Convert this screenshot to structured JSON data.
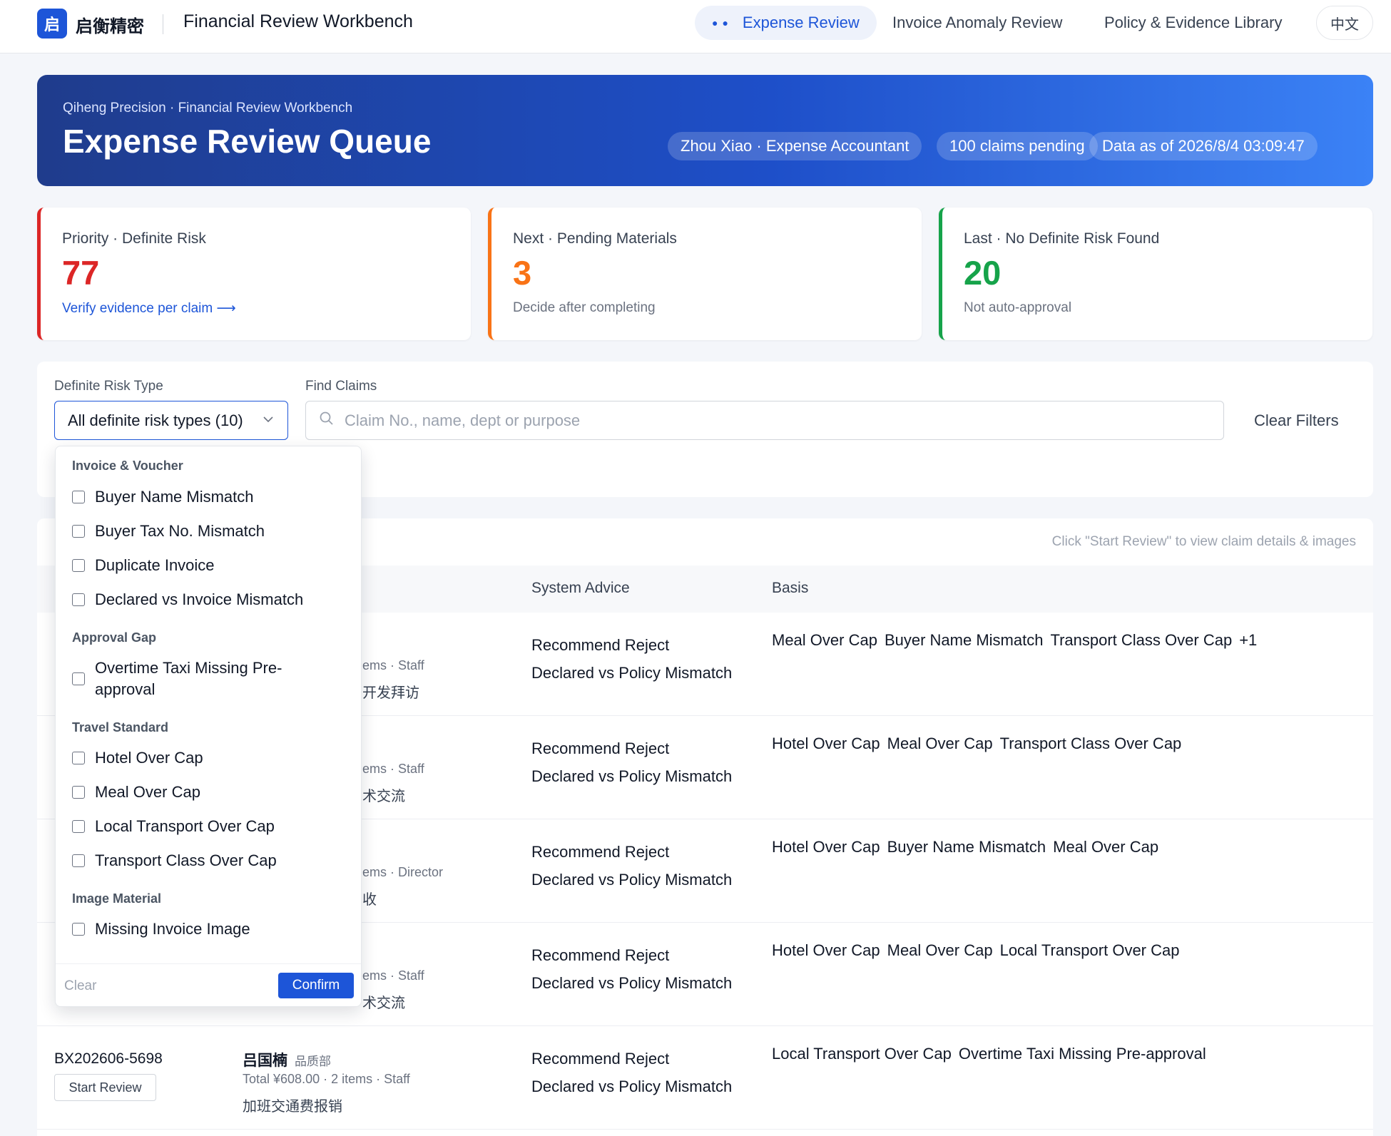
{
  "app": {
    "logo_char": "启",
    "brand": "启衡精密",
    "title": "Financial Review Workbench",
    "nav": [
      {
        "label": "Expense Review",
        "active": true
      },
      {
        "label": "Invoice Anomaly Review",
        "active": false
      },
      {
        "label": "Policy & Evidence Library",
        "active": false
      }
    ],
    "lang": "中文"
  },
  "hero": {
    "subtitle": "Qiheng Precision · Financial Review Workbench",
    "title": "Expense Review Queue",
    "user": "Zhou Xiao · Expense Accountant",
    "pending": "100 claims pending",
    "data_as_of": "Data as of 2026/8/4 03:09:47"
  },
  "stats": [
    {
      "label": "Priority · Definite Risk",
      "value": "77",
      "foot": "Verify evidence per claim",
      "link": true,
      "color": "#dc2626"
    },
    {
      "label": "Next · Pending Materials",
      "value": "3",
      "foot": "Decide after completing",
      "link": false,
      "color": "#f97316"
    },
    {
      "label": "Last · No Definite Risk Found",
      "value": "20",
      "foot": "Not auto-approval",
      "link": false,
      "color": "#16a34a"
    }
  ],
  "filters": {
    "risk_label": "Definite Risk Type",
    "risk_value": "All definite risk types (10)",
    "search_label": "Find Claims",
    "search_placeholder": "Claim No., name, dept or purpose",
    "clear": "Clear Filters"
  },
  "table": {
    "hint": "Click \"Start Review\" to view claim details & images",
    "headers": {
      "advice": "System Advice",
      "basis": "Basis"
    },
    "start_label": "Start Review",
    "rows": [
      {
        "meta": "ems · Staff",
        "purpose": "开发拜访",
        "advice1": "Recommend Reject",
        "advice2": "Declared vs Policy Mismatch",
        "basis": [
          "Meal Over Cap",
          "Buyer Name Mismatch",
          "Transport Class Over Cap",
          "+1"
        ]
      },
      {
        "meta": "ems · Staff",
        "purpose": "术交流",
        "advice1": "Recommend Reject",
        "advice2": "Declared vs Policy Mismatch",
        "basis": [
          "Hotel Over Cap",
          "Meal Over Cap",
          "Transport Class Over Cap"
        ]
      },
      {
        "meta": "ems · Director",
        "purpose": "收",
        "advice1": "Recommend Reject",
        "advice2": "Declared vs Policy Mismatch",
        "basis": [
          "Hotel Over Cap",
          "Buyer Name Mismatch",
          "Meal Over Cap"
        ]
      },
      {
        "meta": "ems · Staff",
        "purpose": "术交流",
        "advice1": "Recommend Reject",
        "advice2": "Declared vs Policy Mismatch",
        "basis": [
          "Hotel Over Cap",
          "Meal Over Cap",
          "Local Transport Over Cap"
        ]
      },
      {
        "claim_no": "BX202606-5698",
        "name": "吕国楠",
        "dept": "品质部",
        "meta": "Total ¥608.00 · 2 items · Staff",
        "purpose": "加班交通费报销",
        "advice1": "Recommend Reject",
        "advice2": "Declared vs Policy Mismatch",
        "basis": [
          "Local Transport Over Cap",
          "Overtime Taxi Missing Pre-approval"
        ]
      }
    ]
  },
  "dropdown": {
    "groups": [
      {
        "label": "Invoice & Voucher",
        "options": [
          "Buyer Name Mismatch",
          "Buyer Tax No. Mismatch",
          "Duplicate Invoice",
          "Declared vs Invoice Mismatch"
        ]
      },
      {
        "label": "Approval Gap",
        "options": [
          "Overtime Taxi Missing Pre-approval"
        ]
      },
      {
        "label": "Travel Standard",
        "options": [
          "Hotel Over Cap",
          "Meal Over Cap",
          "Local Transport Over Cap",
          "Transport Class Over Cap"
        ]
      },
      {
        "label": "Image Material",
        "options": [
          "Missing Invoice Image"
        ]
      }
    ],
    "clear": "Clear",
    "confirm": "Confirm"
  },
  "colors": {
    "accent": "#1d55d8",
    "danger": "#dc2626",
    "warning": "#f97316",
    "success": "#16a34a"
  },
  "icons": [
    "search-icon",
    "chevron-down-icon",
    "arrow-right-icon",
    "checkbox-icon"
  ]
}
